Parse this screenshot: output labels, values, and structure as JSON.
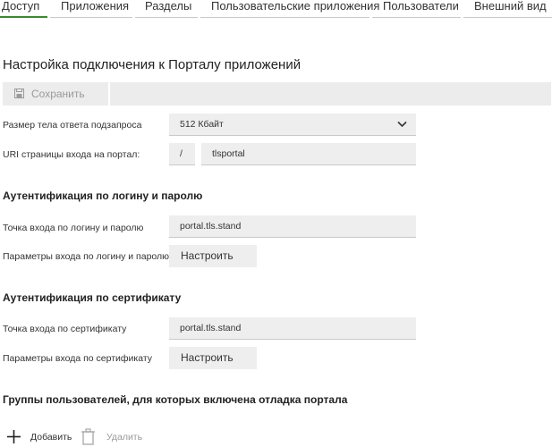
{
  "tabs": [
    {
      "label": "Доступ",
      "active": true
    },
    {
      "label": "Приложения",
      "active": false
    },
    {
      "label": "Разделы",
      "active": false
    },
    {
      "label": "Пользовательские приложения",
      "active": false
    },
    {
      "label": "Пользователи",
      "active": false
    },
    {
      "label": "Внешний вид",
      "active": false
    }
  ],
  "page_title": "Настройка подключения к Порталу приложений",
  "toolbar": {
    "save_label": "Сохранить",
    "save_icon": "floppy-disk-icon",
    "save_enabled": false
  },
  "settings": {
    "response_size": {
      "label": "Размер тела ответа подзапроса",
      "value": "512 Кбайт"
    },
    "portal_uri": {
      "label": "URI страницы входа на портал:",
      "prefix": "/",
      "value": "tlsportal"
    }
  },
  "login_auth": {
    "heading": "Аутентификация по логину и паролю",
    "entry_label": "Точка входа по логину и паролю",
    "entry_value": "portal.tls.stand",
    "params_label": "Параметры входа по логину и паролю",
    "configure_label": "Настроить"
  },
  "cert_auth": {
    "heading": "Аутентификация по сертификату",
    "entry_label": "Точка входа по сертификату",
    "entry_value": "portal.tls.stand",
    "params_label": "Параметры входа по сертификату",
    "configure_label": "Настроить"
  },
  "debug_groups": {
    "heading": "Группы пользователей, для которых включена отладка портала",
    "add_label": "Добавить",
    "delete_label": "Удалить"
  },
  "colors": {
    "accent": "#3a8a2e",
    "field_bg": "#eeeeee",
    "toolbar_bg": "#ececec",
    "disabled_text": "#9a9a9a"
  }
}
